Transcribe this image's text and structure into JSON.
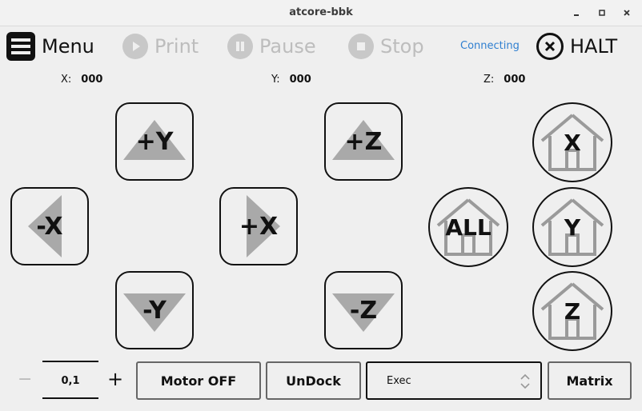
{
  "window": {
    "title": "atcore-bbk"
  },
  "toolbar": {
    "menu_label": "Menu",
    "print_label": "Print",
    "pause_label": "Pause",
    "stop_label": "Stop",
    "status": "Connecting",
    "halt_label": "HALT"
  },
  "position": {
    "x_label": "X:",
    "x_value": "000",
    "y_label": "Y:",
    "y_value": "000",
    "z_label": "Z:",
    "z_value": "000"
  },
  "jog": {
    "plus_y": "+Y",
    "minus_x": "-X",
    "plus_x": "+X",
    "minus_y": "-Y",
    "plus_z": "+Z",
    "minus_z": "-Z"
  },
  "home": {
    "all": "ALL",
    "x": "X",
    "y": "Y",
    "z": "Z"
  },
  "bottom": {
    "step_minus": "−",
    "step_value": "0,1",
    "step_plus": "+",
    "motor_off_label": "Motor OFF",
    "undock_label": "UnDock",
    "mode_value": "Exec",
    "matrix_label": "Matrix"
  },
  "icons": {
    "menu": "hamburger-menu-icon",
    "print": "play-icon",
    "pause": "pause-icon",
    "stop": "stop-icon",
    "halt": "close-circle-icon",
    "home": "house-icon",
    "arrow": "triangle-arrow-icon"
  },
  "colors": {
    "background": "#efefef",
    "status": "#2f7fd0",
    "disabled": "#bdbdbd",
    "arrow": "#a9a9a9",
    "home_icon": "#9a9a9a"
  }
}
